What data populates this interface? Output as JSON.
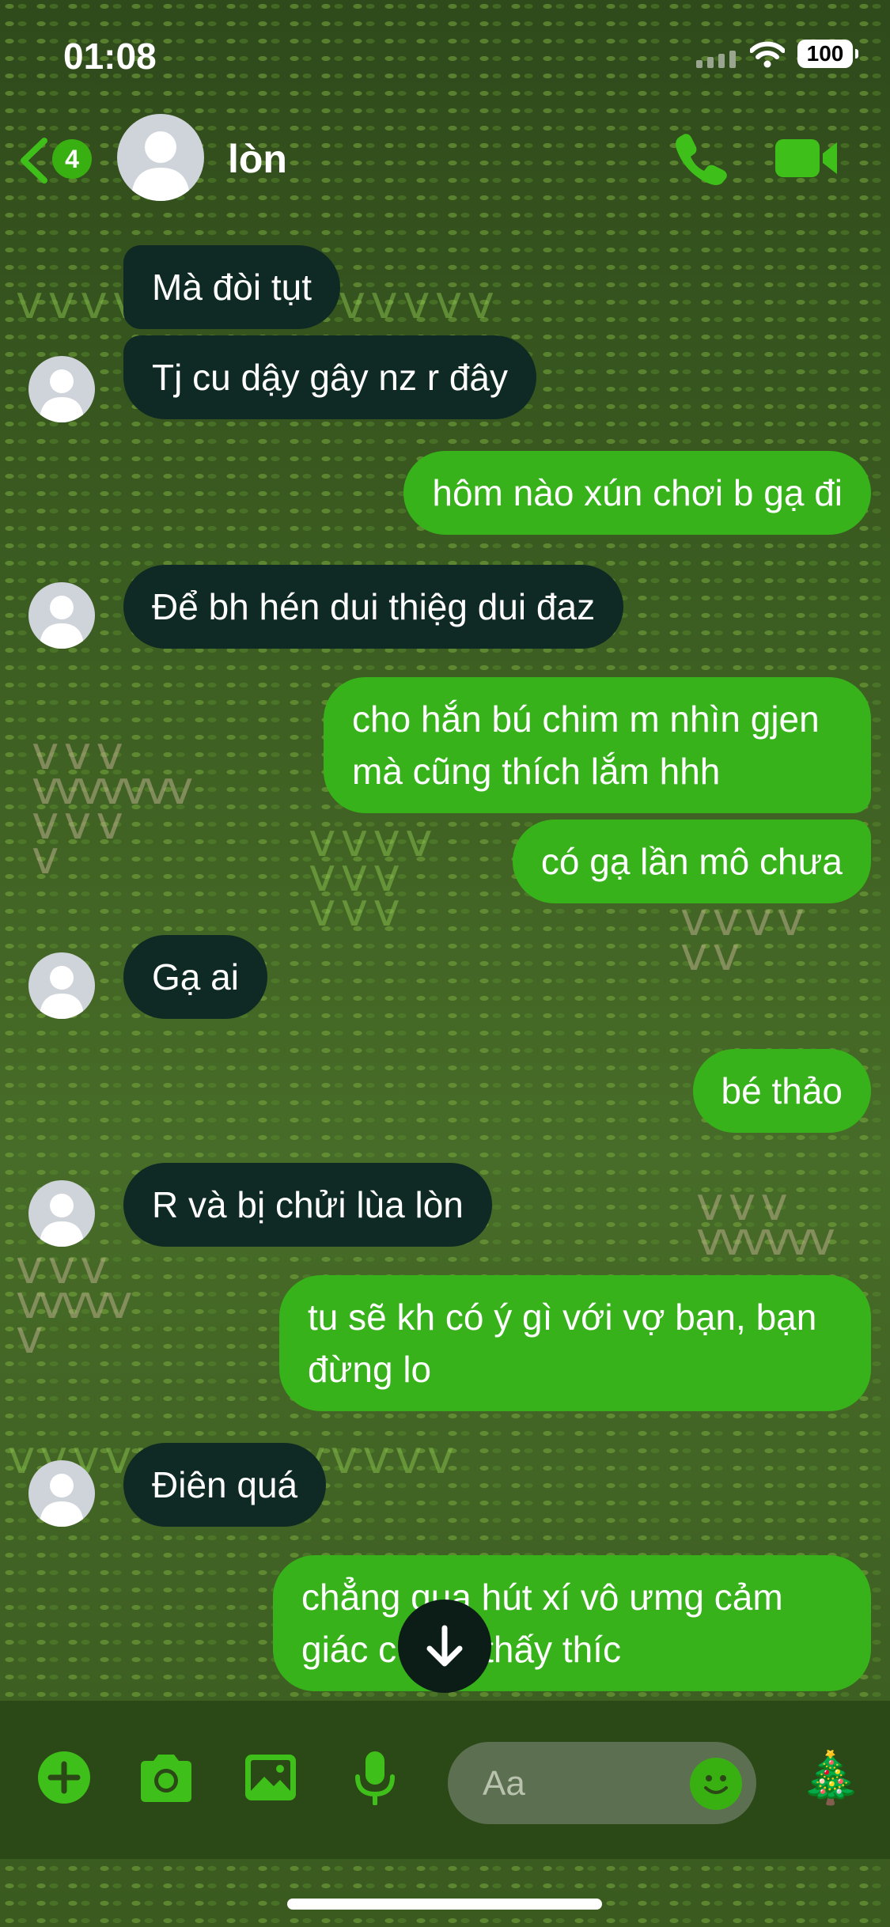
{
  "status_bar": {
    "time": "01:08",
    "battery": "100"
  },
  "header": {
    "back_badge": "4",
    "contact_name": "lòn"
  },
  "messages": [
    {
      "dir": "in",
      "text": "Mà đòi tụt"
    },
    {
      "dir": "in",
      "text": "Tj cu dậy gây nz r đây"
    },
    {
      "dir": "out",
      "text": "hôm nào xún chơi b gạ đi"
    },
    {
      "dir": "in",
      "text": "Để bh hén dui thiệg dui đaz"
    },
    {
      "dir": "out",
      "text": "cho hắn bú chim m nhìn gjen mà cũng thích lắm hhh"
    },
    {
      "dir": "out",
      "text": "có gạ lần mô chưa"
    },
    {
      "dir": "in",
      "text": "Gạ ai"
    },
    {
      "dir": "out",
      "text": "bé thảo"
    },
    {
      "dir": "in",
      "text": "R và bị chửi lùa lòn"
    },
    {
      "dir": "out",
      "text": "tu sẽ kh có ý gì với vợ bạn, bạn đừng lo"
    },
    {
      "dir": "in",
      "text": "Điên quá"
    },
    {
      "dir": "out",
      "text": "chẳng qua hút xí vô ưmg cảm giác c vs b thấy thíc"
    }
  ],
  "composer": {
    "placeholder": "Aa",
    "tree_emoji": "🎄"
  },
  "icons": [
    "back-chevron-icon",
    "phone-icon",
    "video-camera-icon",
    "plus-icon",
    "camera-icon",
    "image-icon",
    "microphone-icon",
    "smiley-icon",
    "arrow-down-icon"
  ],
  "colors": {
    "accent": "#37b21b",
    "incoming_bubble": "#0f2a24",
    "background": "#3a5a20"
  }
}
